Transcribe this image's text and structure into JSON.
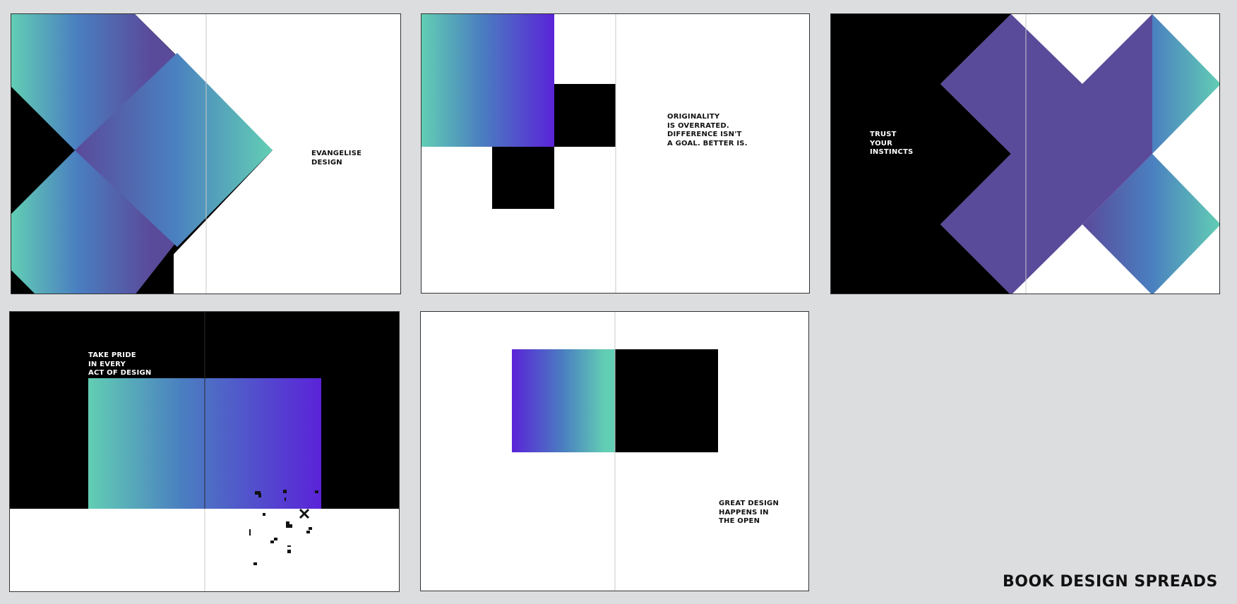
{
  "page_label": "BOOK DESIGN SPREADS",
  "colors": {
    "background": "#dcdddf",
    "black": "#000000",
    "white": "#ffffff",
    "teal": "#62ceb4",
    "blue": "#4a7fc0",
    "violet": "#5a4a9a",
    "purple": "#5a23d8",
    "gutter": "#c8c8c8"
  },
  "spreads": [
    {
      "id": "evangelise",
      "caption": "EVANGELISE\nDESIGN"
    },
    {
      "id": "originality",
      "caption": "ORIGINALITY\nIS OVERRATED.\nDIFFERENCE ISN'T\nA GOAL. BETTER IS."
    },
    {
      "id": "trust",
      "caption": "TRUST\nYOUR\nINSTINCTS"
    },
    {
      "id": "take-pride",
      "caption": "TAKE PRIDE\nIN EVERY\nACT OF DESIGN"
    },
    {
      "id": "great-design",
      "caption": "GREAT DESIGN\nHAPPENS IN\nTHE OPEN"
    }
  ]
}
